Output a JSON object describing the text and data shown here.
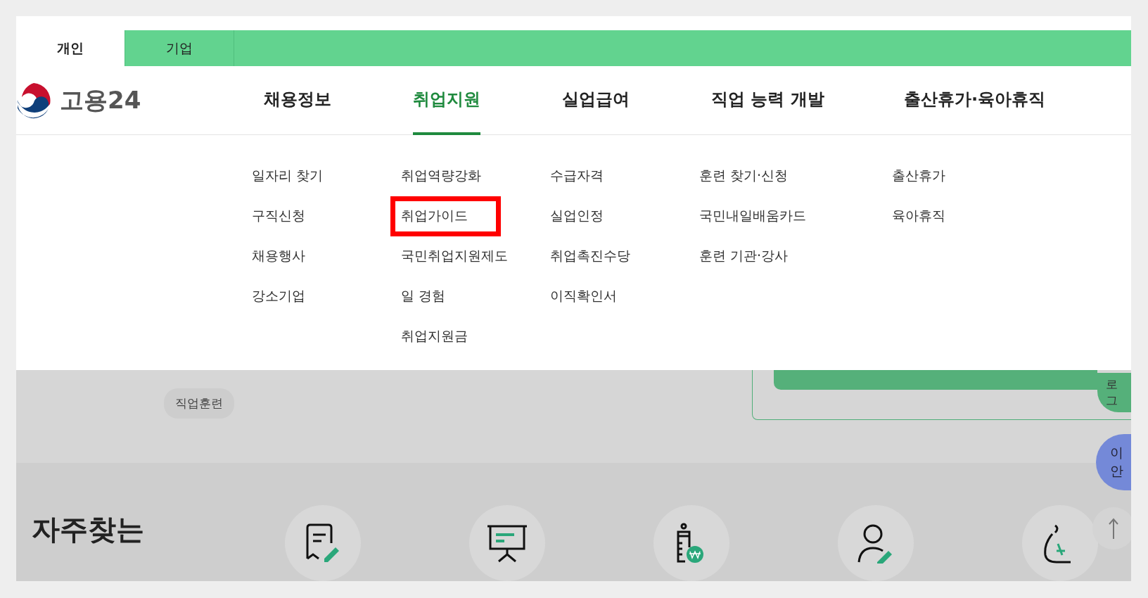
{
  "user_tabs": [
    {
      "label": "개인",
      "selected": true
    },
    {
      "label": "기업",
      "selected": false
    }
  ],
  "logo": {
    "text": "고용24"
  },
  "menu": [
    {
      "label": "채용정보",
      "selected": false,
      "items": [
        {
          "label": "일자리 찾기",
          "highlighted": false
        },
        {
          "label": "구직신청",
          "highlighted": false
        },
        {
          "label": "채용행사",
          "highlighted": false
        },
        {
          "label": "강소기업",
          "highlighted": false
        }
      ]
    },
    {
      "label": "취업지원",
      "selected": true,
      "items": [
        {
          "label": "취업역량강화",
          "highlighted": false
        },
        {
          "label": "취업가이드",
          "highlighted": true
        },
        {
          "label": "국민취업지원제도",
          "highlighted": false
        },
        {
          "label": "일 경험",
          "highlighted": false
        },
        {
          "label": "취업지원금",
          "highlighted": false
        }
      ]
    },
    {
      "label": "실업급여",
      "selected": false,
      "items": [
        {
          "label": "수급자격",
          "highlighted": false
        },
        {
          "label": "실업인정",
          "highlighted": false
        },
        {
          "label": "취업촉진수당",
          "highlighted": false
        },
        {
          "label": "이직확인서",
          "highlighted": false
        }
      ]
    },
    {
      "label": "직업 능력 개발",
      "selected": false,
      "items": [
        {
          "label": "훈련 찾기·신청",
          "highlighted": false
        },
        {
          "label": "국민내일배움카드",
          "highlighted": false
        },
        {
          "label": "훈련 기관·강사",
          "highlighted": false
        }
      ]
    },
    {
      "label": "출산휴가·육아휴직",
      "selected": false,
      "items": [
        {
          "label": "출산휴가",
          "highlighted": false
        },
        {
          "label": "육아휴직",
          "highlighted": false
        }
      ]
    }
  ],
  "keyword_tags": [
    "직업훈련"
  ],
  "login_button": {
    "label": "로그"
  },
  "guide_button": {
    "lines": [
      "이",
      "안"
    ]
  },
  "frequent_services": {
    "title": "자주찾는",
    "items": [
      {
        "kind": "document"
      },
      {
        "kind": "presentation"
      },
      {
        "kind": "bottle"
      },
      {
        "kind": "person"
      },
      {
        "kind": "moneybag"
      }
    ]
  }
}
